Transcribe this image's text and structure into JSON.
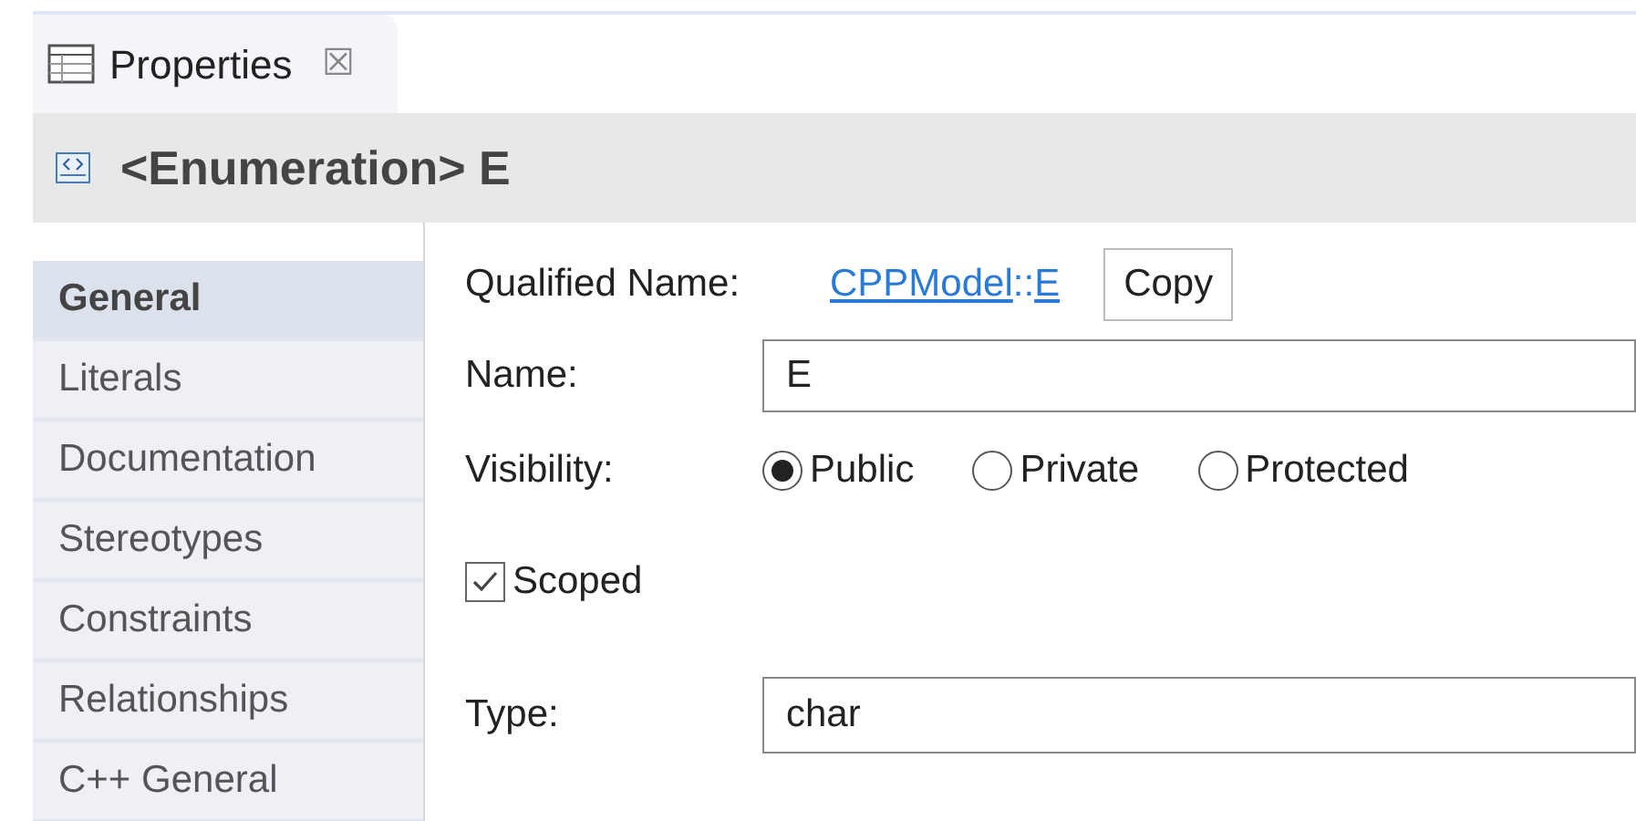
{
  "view_tab": {
    "label": "Properties",
    "close": "☒",
    "selected": true
  },
  "header": {
    "title": "<Enumeration> E"
  },
  "sidebar": {
    "items": [
      {
        "label": "General",
        "selected": true
      },
      {
        "label": "Literals",
        "selected": false
      },
      {
        "label": "Documentation",
        "selected": false
      },
      {
        "label": "Stereotypes",
        "selected": false
      },
      {
        "label": "Constraints",
        "selected": false
      },
      {
        "label": "Relationships",
        "selected": false
      },
      {
        "label": "C++ General",
        "selected": false
      }
    ]
  },
  "qualified_name": {
    "label": "Qualified Name:",
    "parts": [
      {
        "text": "CPPModel",
        "kind": "link"
      },
      {
        "text": "::",
        "kind": "separator"
      },
      {
        "text": "E",
        "kind": "link"
      }
    ],
    "button": "Copy"
  },
  "name": {
    "label": "Name:",
    "value": "E"
  },
  "visibility": {
    "label": "Visibility:",
    "options": [
      {
        "label": "Public",
        "selected": true
      },
      {
        "label": "Private",
        "selected": false
      },
      {
        "label": "Protected",
        "selected": false
      }
    ]
  },
  "scoped": {
    "label": "Scoped",
    "checked": true
  },
  "type": {
    "label": "Type:",
    "value": "char"
  }
}
